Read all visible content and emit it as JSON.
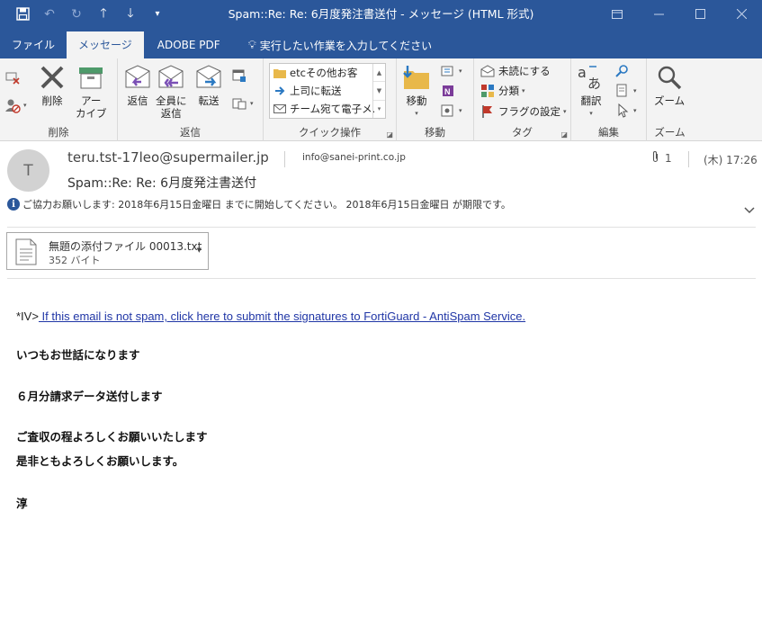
{
  "window": {
    "title": "Spam::Re: Re: 6月度発注書送付  -  メッセージ (HTML 形式)"
  },
  "tabs": [
    {
      "label": "ファイル"
    },
    {
      "label": "メッセージ"
    },
    {
      "label": "ADOBE PDF"
    }
  ],
  "tell_me": "実行したい作業を入力してください",
  "ribbon": {
    "delete_group": {
      "label": "削除",
      "delete": "削除",
      "archive_l1": "アー",
      "archive_l2": "カイブ"
    },
    "reply_group": {
      "label": "返信",
      "reply": "返信",
      "reply_all_l1": "全員に",
      "reply_all_l2": "返信",
      "forward": "転送"
    },
    "quick_group": {
      "label": "クイック操作",
      "items": [
        "etcその他お客",
        "上司に転送",
        "チーム宛て電子メ…"
      ]
    },
    "move_group": {
      "label": "移動",
      "move": "移動"
    },
    "tags_group": {
      "label": "タグ",
      "unread": "未読にする",
      "categorize": "分類",
      "followup": "フラグの設定"
    },
    "edit_group": {
      "label": "編集",
      "translate": "翻訳"
    },
    "zoom_group": {
      "label": "ズーム",
      "zoom": "ズーム"
    }
  },
  "message": {
    "avatar_initial": "T",
    "sender": "teru.tst-17leo@supermailer.jp",
    "to": "info@sanei-print.co.jp",
    "attachment_count": "1",
    "date": "(木) 17:26",
    "subject": "Spam::Re: Re: 6月度発注書送付",
    "info": "ご協力お願いします:  2018年6月15日金曜日 までに開始してください。 2018年6月15日金曜日 が期限です。"
  },
  "attachment": {
    "name": "無題の添付ファイル 00013.txt",
    "size": "352 バイト"
  },
  "body": {
    "spam_prefix": "*IV>",
    "spam_link": " If this email is not spam, click here to submit the signatures to FortiGuard - AntiSpam Service.",
    "lines": [
      "いつもお世話になります",
      "６月分請求データ送付します",
      "ご査収の程よろしくお願いいたします",
      "是非ともよろしくお願いします。",
      "淳"
    ]
  },
  "colors": {
    "accent": "#2b579a",
    "link": "#2036a6",
    "ribbon_bg": "#f3f3f3"
  }
}
